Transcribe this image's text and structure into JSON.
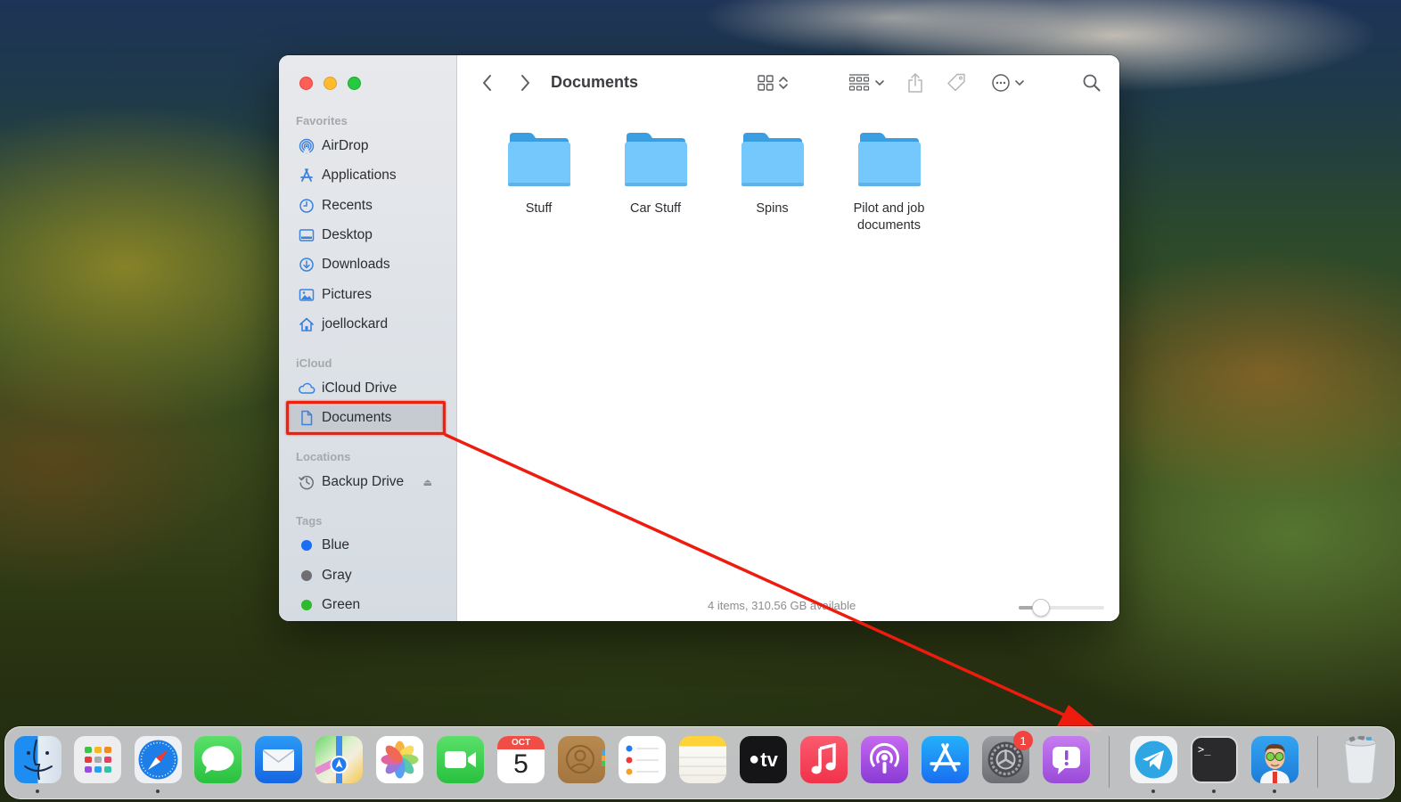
{
  "window": {
    "title": "Documents",
    "traffic_lights": {
      "close": "#fe5f57",
      "minimize": "#febc2e",
      "maximize": "#28c840"
    }
  },
  "sidebar": {
    "sections": [
      {
        "title": "Favorites",
        "items": [
          {
            "label": "AirDrop",
            "icon": "airdrop-icon"
          },
          {
            "label": "Applications",
            "icon": "applications-icon"
          },
          {
            "label": "Recents",
            "icon": "clock-icon"
          },
          {
            "label": "Desktop",
            "icon": "desktop-icon"
          },
          {
            "label": "Downloads",
            "icon": "download-icon"
          },
          {
            "label": "Pictures",
            "icon": "pictures-icon"
          },
          {
            "label": "joellockard",
            "icon": "home-icon"
          }
        ]
      },
      {
        "title": "iCloud",
        "items": [
          {
            "label": "iCloud Drive",
            "icon": "cloud-icon"
          },
          {
            "label": "Documents",
            "icon": "document-icon",
            "selected": true
          }
        ]
      },
      {
        "title": "Locations",
        "items": [
          {
            "label": "Backup Drive",
            "icon": "time-machine-icon",
            "eject": "⏏"
          }
        ]
      },
      {
        "title": "Tags",
        "items": [
          {
            "label": "Blue",
            "color": "#1a6ef5"
          },
          {
            "label": "Gray",
            "color": "#6e6e73"
          },
          {
            "label": "Green",
            "color": "#2cbb2c"
          }
        ]
      }
    ]
  },
  "toolbar": {
    "back": "back-chevron-icon",
    "forward": "forward-chevron-icon",
    "title": "Documents",
    "view_mode": "icon-view",
    "group_by": "group-by",
    "share": "share-icon",
    "tag": "tag-icon",
    "more": "ellipsis-circle-icon",
    "search": "search-icon"
  },
  "files": [
    {
      "name": "Stuff",
      "type": "folder"
    },
    {
      "name": "Car Stuff",
      "type": "folder"
    },
    {
      "name": "Spins",
      "type": "folder"
    },
    {
      "name": "Pilot and job documents",
      "type": "folder"
    }
  ],
  "status": {
    "text": "4 items, 310.56 GB available",
    "icon_size_fraction": 0.25
  },
  "annotation": {
    "color": "#ee2010",
    "target": "Documents (iCloud)",
    "arrow_to": "Dock separator"
  },
  "dock": {
    "apps": [
      {
        "name": "Finder",
        "running": true
      },
      {
        "name": "Launchpad",
        "running": false
      },
      {
        "name": "Safari",
        "running": true
      },
      {
        "name": "Messages",
        "running": false
      },
      {
        "name": "Mail",
        "running": false
      },
      {
        "name": "Maps",
        "running": false
      },
      {
        "name": "Photos",
        "running": false
      },
      {
        "name": "FaceTime",
        "running": false
      },
      {
        "name": "Calendar",
        "running": false,
        "month": "OCT",
        "day": "5"
      },
      {
        "name": "Contacts",
        "running": false
      },
      {
        "name": "Reminders",
        "running": false
      },
      {
        "name": "Notes",
        "running": false
      },
      {
        "name": "TV",
        "running": false,
        "label": "tv"
      },
      {
        "name": "Music",
        "running": false
      },
      {
        "name": "Podcasts",
        "running": false
      },
      {
        "name": "App Store",
        "running": false
      },
      {
        "name": "System Preferences",
        "running": false,
        "badge": "1"
      },
      {
        "name": "Feedback Assistant",
        "running": false
      }
    ],
    "recent_apps": [
      {
        "name": "Telegram",
        "running": true
      },
      {
        "name": "Terminal",
        "running": true,
        "prompt": ">_"
      },
      {
        "name": "Character App",
        "running": true
      }
    ],
    "trash": {
      "name": "Trash",
      "state": "full"
    }
  }
}
